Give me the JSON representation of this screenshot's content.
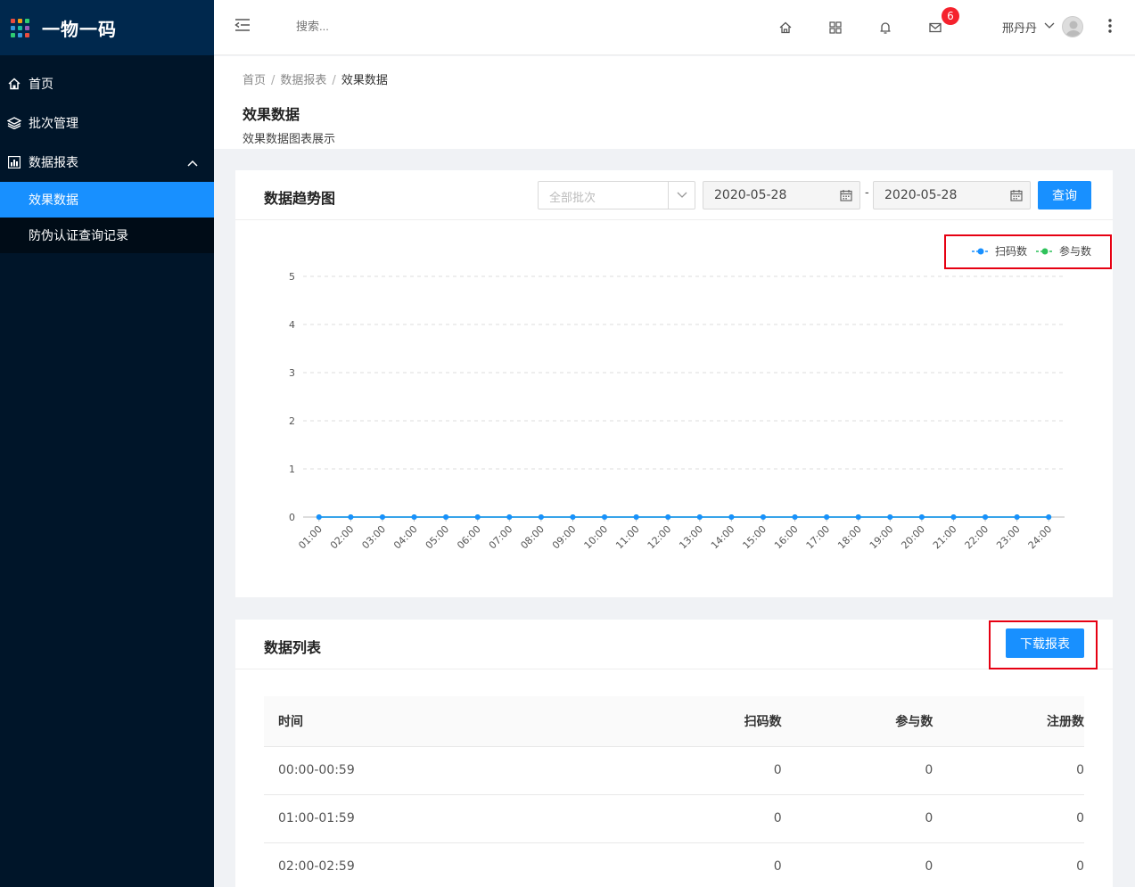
{
  "app": {
    "title": "一物一码"
  },
  "sidebar": {
    "items": [
      {
        "label": "首页"
      },
      {
        "label": "批次管理"
      },
      {
        "label": "数据报表"
      }
    ],
    "submenu": [
      {
        "label": "效果数据"
      },
      {
        "label": "防伪认证查询记录"
      }
    ]
  },
  "header": {
    "search_placeholder": "搜索...",
    "mail_badge": "6",
    "username": "邢丹丹"
  },
  "breadcrumb": {
    "home": "首页",
    "reports": "数据报表",
    "current": "效果数据",
    "sep": "/"
  },
  "page": {
    "title": "效果数据",
    "description": "效果数据图表展示"
  },
  "trend": {
    "title": "数据趋势图",
    "batch_placeholder": "全部批次",
    "date_start": "2020-05-28",
    "date_sep": "-",
    "date_end": "2020-05-28",
    "query_label": "查询"
  },
  "chart_data": {
    "type": "line",
    "x": [
      "01:00",
      "02:00",
      "03:00",
      "04:00",
      "05:00",
      "06:00",
      "07:00",
      "08:00",
      "09:00",
      "10:00",
      "11:00",
      "12:00",
      "13:00",
      "14:00",
      "15:00",
      "16:00",
      "17:00",
      "18:00",
      "19:00",
      "20:00",
      "21:00",
      "22:00",
      "23:00",
      "24:00"
    ],
    "series": [
      {
        "name": "扫码数",
        "color": "#1890ff",
        "values": [
          0,
          0,
          0,
          0,
          0,
          0,
          0,
          0,
          0,
          0,
          0,
          0,
          0,
          0,
          0,
          0,
          0,
          0,
          0,
          0,
          0,
          0,
          0,
          0
        ]
      },
      {
        "name": "参与数",
        "color": "#2fc25b",
        "values": [
          0,
          0,
          0,
          0,
          0,
          0,
          0,
          0,
          0,
          0,
          0,
          0,
          0,
          0,
          0,
          0,
          0,
          0,
          0,
          0,
          0,
          0,
          0,
          0
        ]
      }
    ],
    "ylim": [
      0,
      5
    ],
    "yticks": [
      0,
      1,
      2,
      3,
      4,
      5
    ],
    "grid": true,
    "legend": "top-right"
  },
  "list": {
    "title": "数据列表",
    "download_label": "下载报表",
    "columns": [
      "时间",
      "扫码数",
      "参与数",
      "注册数"
    ],
    "rows": [
      [
        "00:00-00:59",
        "0",
        "0",
        "0"
      ],
      [
        "01:00-01:59",
        "0",
        "0",
        "0"
      ],
      [
        "02:00-02:59",
        "0",
        "0",
        "0"
      ]
    ]
  }
}
